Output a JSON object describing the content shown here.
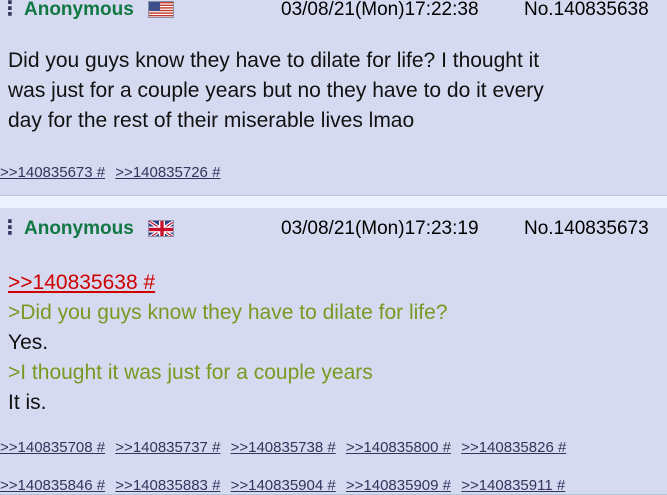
{
  "posts": [
    {
      "name": "Anonymous",
      "flag_icon": "us-flag-icon",
      "datetime": "03/08/21(Mon)17:22:38",
      "post_number": "No.140835638",
      "body_lines": [
        "Did you guys know they have to dilate for life? I thought it",
        "was just for a couple years but no they have to do it every",
        "day for the rest of their miserable lives lmao"
      ],
      "backlinks": [
        ">>140835673 #",
        ">>140835726 #"
      ]
    },
    {
      "name": "Anonymous",
      "flag_icon": "uk-flag-icon",
      "datetime": "03/08/21(Mon)17:23:19",
      "post_number": "No.140835673",
      "quote_link": ">>140835638 #",
      "body_lines": [
        ">Did you guys know they have to dilate for life?",
        "Yes.",
        ">I thought it was just for a couple years",
        "It is."
      ],
      "backlinks_row1": [
        ">>140835708 #",
        ">>140835737 #",
        ">>140835738 #",
        ">>140835800 #",
        ">>140835826 #"
      ],
      "backlinks_row2": [
        ">>140835846 #",
        ">>140835883 #",
        ">>140835904 #",
        ">>140835909 #",
        ">>140835911 #"
      ]
    }
  ],
  "colors": {
    "post_background": "#d6daf0",
    "name": "#117743",
    "quote_link": "#d00000",
    "greentext": "#789922",
    "backlink": "#34345c"
  }
}
